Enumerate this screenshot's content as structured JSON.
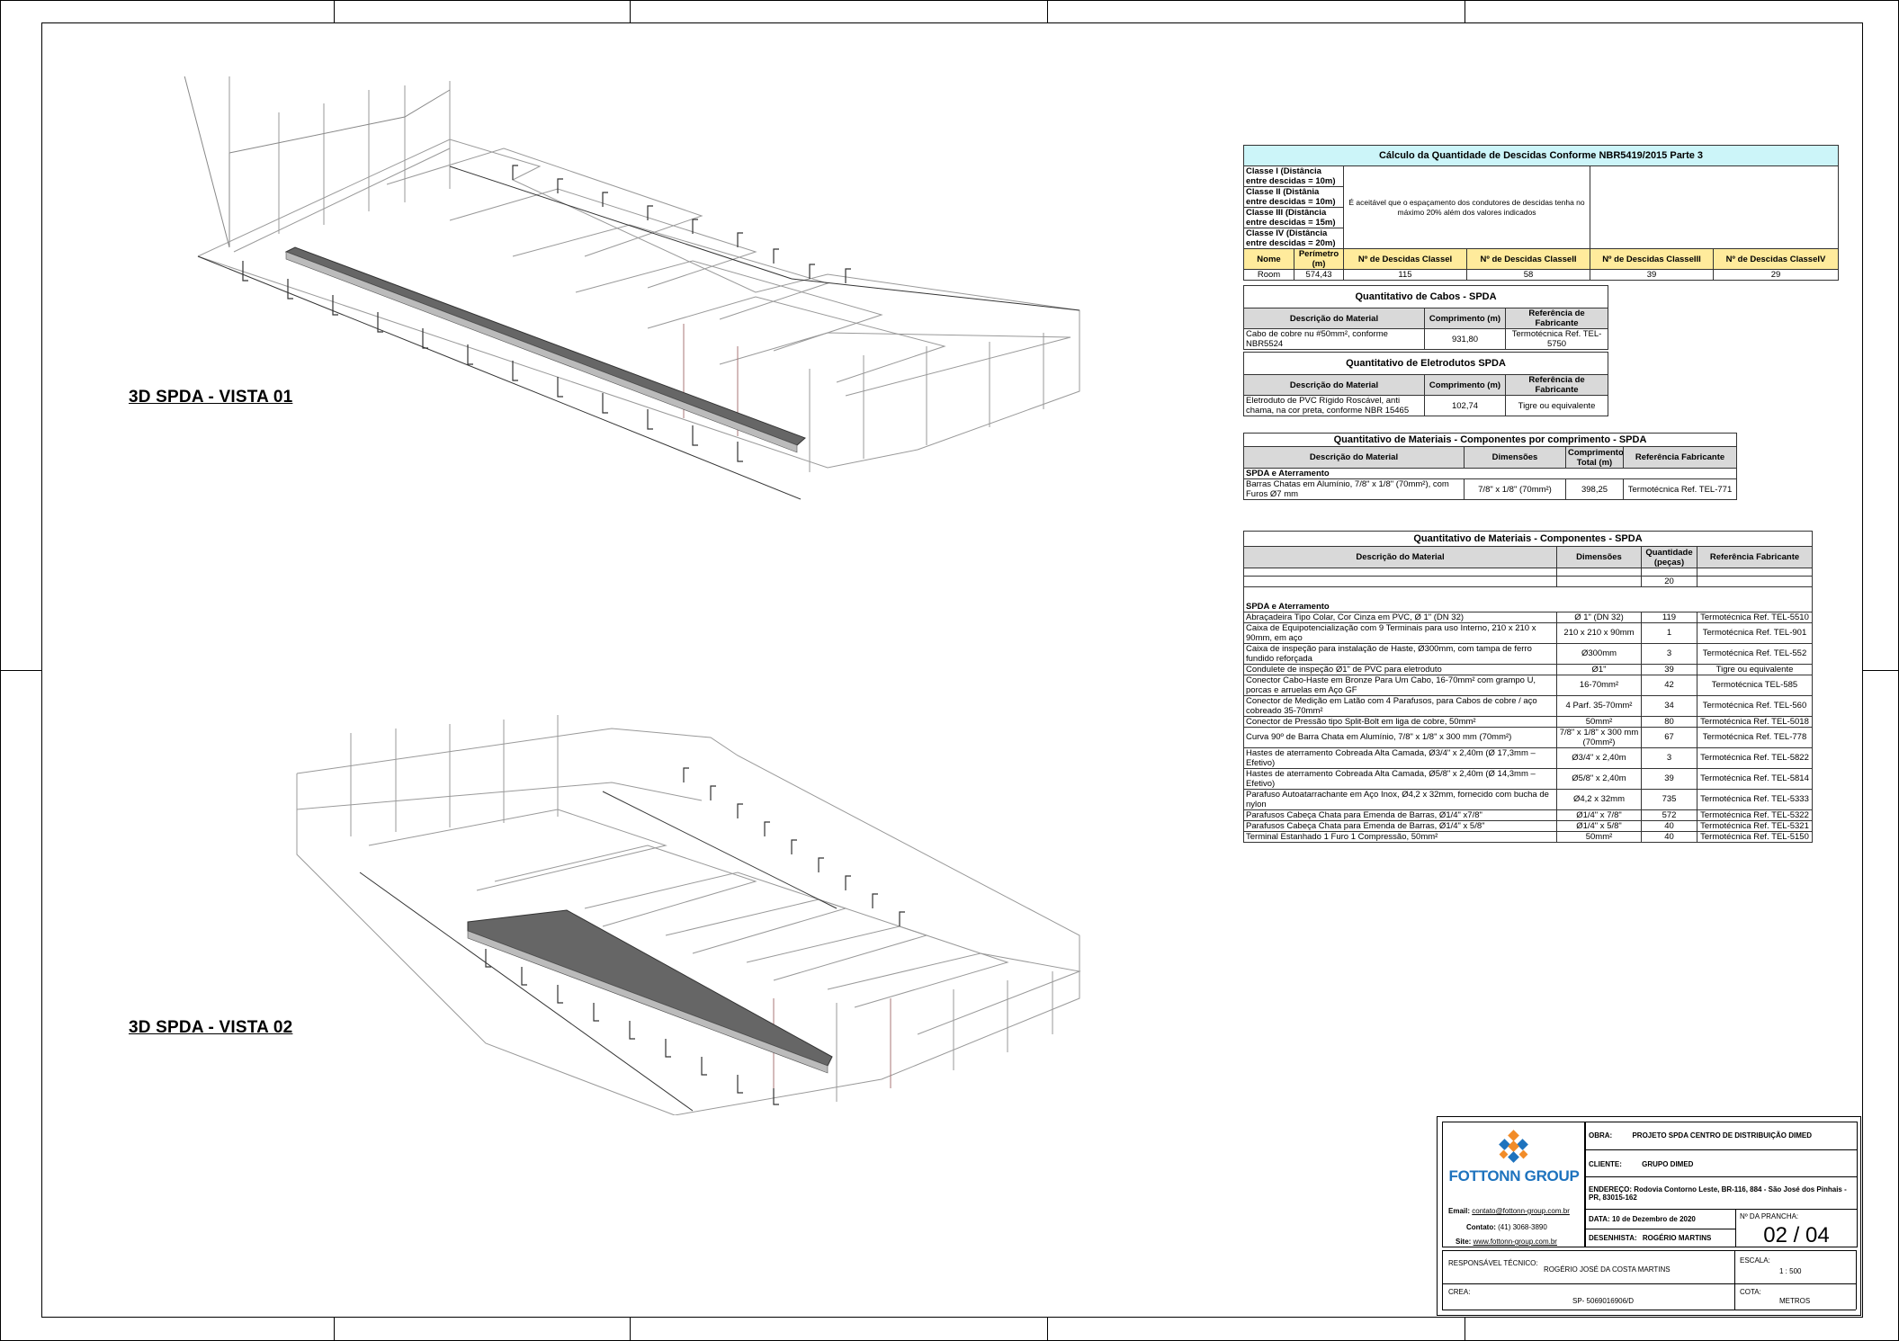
{
  "views": {
    "view1_label": "3D SPDA - VISTA 01",
    "view2_label": "3D SPDA - VISTA 02"
  },
  "descidas": {
    "title": "Cálculo da Quantidade de Descidas Conforme NBR5419/2015  Parte 3",
    "classes": [
      "Classe I (Distância entre descidas = 10m)",
      "Classe II (Distânia entre descidas = 10m)",
      "Classe III (Distância entre descidas = 15m)",
      "Classe IV (Distância entre descidas = 20m)"
    ],
    "note": "É aceitável que o espaçamento dos condutores de descidas tenha no máximo 20% além dos valores indicados",
    "headers": [
      "Nome",
      "Perímetro (m)",
      "Nº de Descidas ClasseI",
      "Nº de Descidas ClasseII",
      "Nº de Descidas ClasseIII",
      "Nº de Descidas ClasseIV"
    ],
    "row": [
      "Room",
      "574,43",
      "115",
      "58",
      "39",
      "29"
    ]
  },
  "cabos": {
    "title": "Quantitativo de Cabos - SPDA",
    "headers": [
      "Descrição do Material",
      "Comprimento (m)",
      "Referência de Fabricante"
    ],
    "rows": [
      [
        "Cabo de cobre nu #50mm², conforme NBR5524",
        "931,80",
        "Termotécnica Ref. TEL-5750"
      ]
    ]
  },
  "eletrodutos": {
    "title": "Quantitativo de Eletrodutos SPDA",
    "headers": [
      "Descrição do Material",
      "Comprimento (m)",
      "Referência de Fabricante"
    ],
    "rows": [
      [
        "Eletroduto de PVC Rígido Roscável, anti chama, na cor preta, conforme NBR 15465",
        "102,74",
        "Tigre ou equivalente"
      ]
    ]
  },
  "comp_comprimento": {
    "title": "Quantitativo de Materiais - Componentes por comprimento - SPDA",
    "headers": [
      "Descrição do Material",
      "Dimensões",
      "Comprimento Total (m)",
      "Referência Fabricante"
    ],
    "section": "SPDA e Aterramento",
    "rows": [
      [
        "Barras Chatas em Alumínio, 7/8\" x 1/8\" (70mm²), com Furos Ø7 mm",
        "7/8\" x 1/8\" (70mm²)",
        "398,25",
        "Termotécnica Ref. TEL-771"
      ]
    ]
  },
  "componentes": {
    "title": "Quantitativo de Materiais - Componentes - SPDA",
    "headers": [
      "Descrição do Material",
      "Dimensões",
      "Quantidade (peças)",
      "Referência Fabricante"
    ],
    "pre_value": "20",
    "section": "SPDA e Aterramento",
    "rows": [
      [
        "Abraçadeira Tipo Colar, Cor Cinza em PVC, Ø 1\" (DN 32)",
        "Ø 1\" (DN 32)",
        "119",
        "Termotécnica Ref. TEL-5510"
      ],
      [
        "Caixa de Equipotencialização com 9 Terminais para uso Interno, 210 x 210 x 90mm, em aço",
        "210 x 210 x 90mm",
        "1",
        "Termotécnica Ref. TEL-901"
      ],
      [
        "Caixa de inspeção para instalação de Haste, Ø300mm, com tampa de ferro fundido reforçada",
        "Ø300mm",
        "3",
        "Termotécnica Ref. TEL-552"
      ],
      [
        "Condulete de inspeção Ø1\" de PVC para eletroduto",
        "Ø1\"",
        "39",
        "Tigre ou equivalente"
      ],
      [
        "Conector Cabo-Haste em Bronze Para Um Cabo, 16-70mm² com grampo U, porcas e arruelas em Aço GF",
        "16-70mm²",
        "42",
        "Termotécnica TEL-585"
      ],
      [
        "Conector de Medição em Latão com 4 Parafusos, para Cabos de cobre / aço cobreado 35-70mm²",
        "4 Parf. 35-70mm²",
        "34",
        "Termotécnica Ref. TEL-560"
      ],
      [
        "Conector de Pressão tipo Split-Bolt em liga de cobre, 50mm²",
        "50mm²",
        "80",
        "Termotécnica Ref. TEL-5018"
      ],
      [
        "Curva 90º de Barra Chata em Alumínio, 7/8\" x 1/8\" x 300 mm (70mm²)",
        "7/8\" x 1/8\" x 300 mm (70mm²)",
        "67",
        "Termotécnica Ref. TEL-778"
      ],
      [
        "Hastes de aterramento Cobreada Alta Camada, Ø3/4\" x 2,40m (Ø 17,3mm – Efetivo)",
        "Ø3/4\" x 2,40m",
        "3",
        "Termotécnica Ref. TEL-5822"
      ],
      [
        "Hastes de aterramento Cobreada Alta Camada, Ø5/8\" x 2,40m (Ø 14,3mm – Efetivo)",
        "Ø5/8\" x 2,40m",
        "39",
        "Termotécnica Ref. TEL-5814"
      ],
      [
        "Parafuso Autoatarrachante em Aço Inox, Ø4,2 x 32mm, fornecido com bucha de nylon",
        "Ø4,2 x 32mm",
        "735",
        "Termotécnica Ref. TEL-5333"
      ],
      [
        "Parafusos Cabeça Chata para Emenda de Barras, Ø1/4\" x7/8\"",
        "Ø1/4\" x 7/8\"",
        "572",
        "Termotécnica Ref. TEL-5322"
      ],
      [
        "Parafusos Cabeça Chata para Emenda de Barras, Ø1/4\" x 5/8\"",
        "Ø1/4\" x 5/8\"",
        "40",
        "Termotécnica Ref. TEL-5321"
      ],
      [
        "Terminal Estanhado 1 Furo 1 Compressão, 50mm²",
        "50mm²",
        "40",
        "Termotécnica Ref. TEL-5150"
      ]
    ]
  },
  "title_block": {
    "brand": "FOTTONN GROUP",
    "email_label": "Email:",
    "email": "contato@fottonn-group.com.br",
    "phone_label": "Contato:",
    "phone": "(41) 3068-3890",
    "site_label": "Site:",
    "site": "www.fottonn-group.com.br",
    "obra_label": "OBRA:",
    "obra": "PROJETO  SPDA CENTRO  DE DISTRIBUIÇÃO  DIMED",
    "cliente_label": "CLIENTE:",
    "cliente": "GRUPO DIMED",
    "endereco_label": "ENDEREÇO:",
    "endereco": "Rodovia Contorno  Leste, BR-116,  884 - São José  dos  Pinhais - PR, 83015-162",
    "data_label": "DATA:",
    "data": "10 de Dezembro de 2020",
    "prancha_label": "Nº DA PRANCHA:",
    "prancha": "02 / 04",
    "desenhista_label": "DESENHISTA:",
    "desenhista": "ROGÉRIO  MARTINS",
    "responsavel_label": "RESPONSÁVEL TÉCNICO:",
    "responsavel": "ROGÉRIO  JOSÉ DA COSTA  MARTINS",
    "escala_label": "ESCALA:",
    "escala": "1 : 500",
    "crea_label": "CREA:",
    "crea": "SP- 5069016906/D",
    "cota_label": "COTA:",
    "cota": "METROS"
  }
}
